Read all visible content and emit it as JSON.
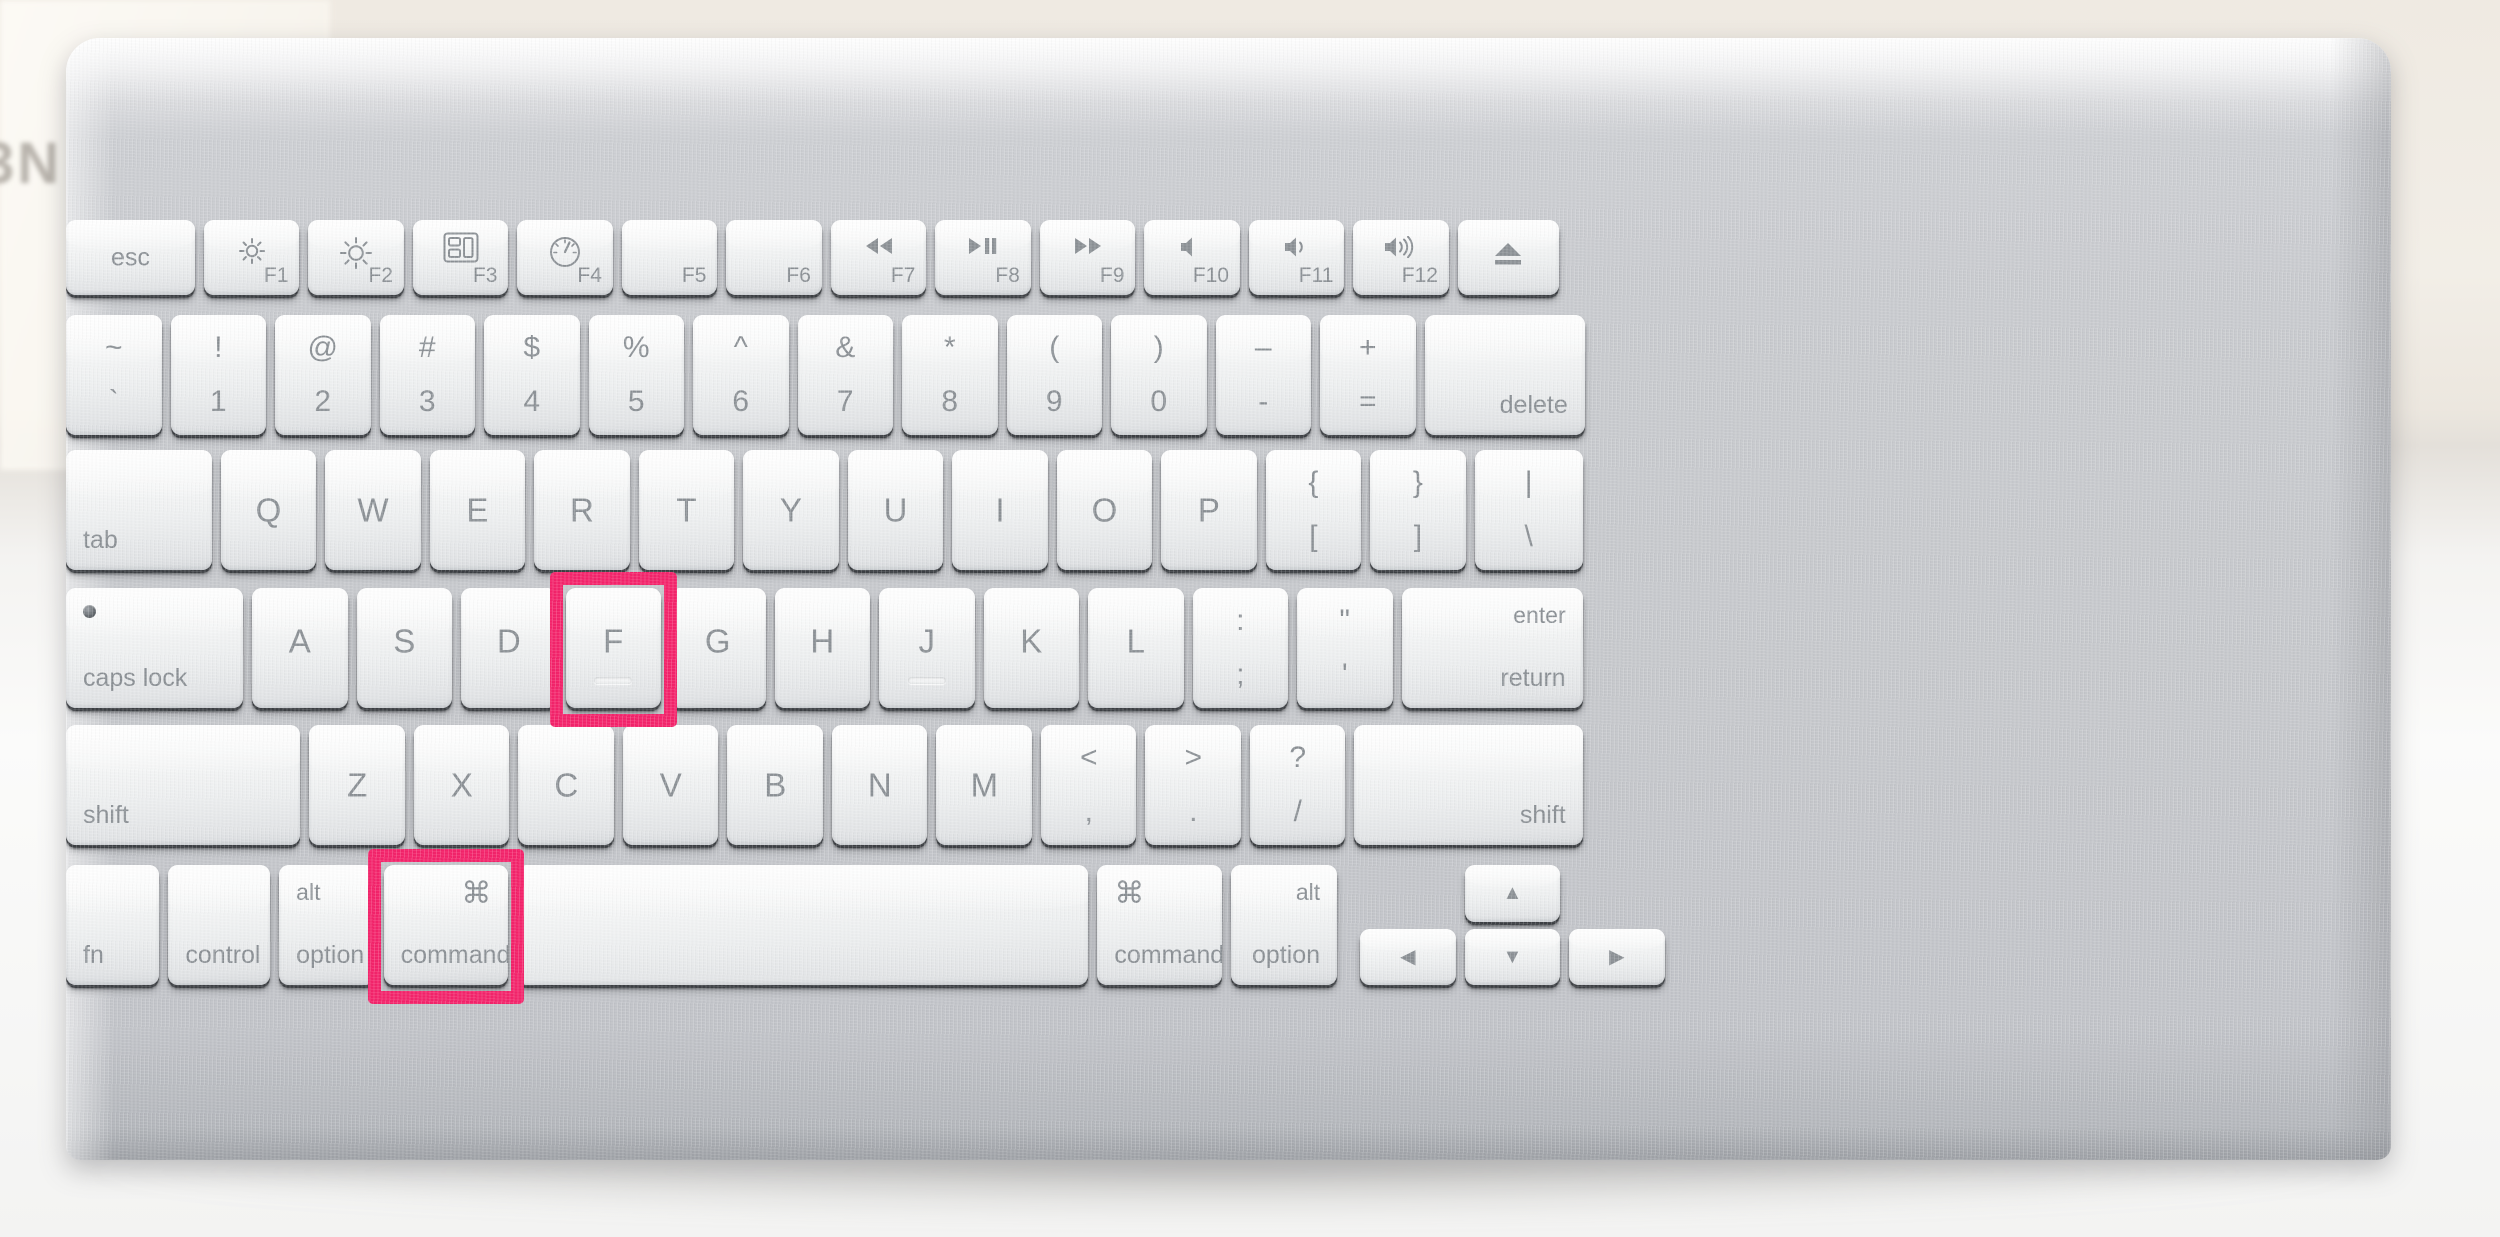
{
  "scene": {
    "device": "Apple Wireless Keyboard",
    "highlight_color": "#F4246B",
    "key_label_color": "#8c9196",
    "body_color": "#c6c8cc",
    "background_color": "#efece6"
  },
  "highlights": [
    {
      "name": "highlight-f-key",
      "key": "F"
    },
    {
      "name": "highlight-command-key",
      "key": "command"
    }
  ],
  "rows": {
    "function_row": [
      {
        "id": "esc",
        "label": "esc",
        "fn": ""
      },
      {
        "id": "f1",
        "label": "",
        "fn": "F1",
        "icon": "brightness-down-icon"
      },
      {
        "id": "f2",
        "label": "",
        "fn": "F2",
        "icon": "brightness-up-icon"
      },
      {
        "id": "f3",
        "label": "",
        "fn": "F3",
        "icon": "mission-control-icon"
      },
      {
        "id": "f4",
        "label": "",
        "fn": "F4",
        "icon": "dashboard-icon"
      },
      {
        "id": "f5",
        "label": "",
        "fn": "F5",
        "icon": ""
      },
      {
        "id": "f6",
        "label": "",
        "fn": "F6",
        "icon": ""
      },
      {
        "id": "f7",
        "label": "",
        "fn": "F7",
        "icon": "rewind-icon"
      },
      {
        "id": "f8",
        "label": "",
        "fn": "F8",
        "icon": "play-pause-icon"
      },
      {
        "id": "f9",
        "label": "",
        "fn": "F9",
        "icon": "fast-forward-icon"
      },
      {
        "id": "f10",
        "label": "",
        "fn": "F10",
        "icon": "mute-icon"
      },
      {
        "id": "f11",
        "label": "",
        "fn": "F11",
        "icon": "volume-down-icon"
      },
      {
        "id": "f12",
        "label": "",
        "fn": "F12",
        "icon": "volume-up-icon"
      },
      {
        "id": "eject",
        "label": "",
        "fn": "",
        "icon": "eject-icon"
      }
    ],
    "number_row": [
      {
        "id": "grave",
        "top": "~",
        "bottom": "`"
      },
      {
        "id": "1",
        "top": "!",
        "bottom": "1"
      },
      {
        "id": "2",
        "top": "@",
        "bottom": "2"
      },
      {
        "id": "3",
        "top": "#",
        "bottom": "3"
      },
      {
        "id": "4",
        "top": "$",
        "bottom": "4"
      },
      {
        "id": "5",
        "top": "%",
        "bottom": "5"
      },
      {
        "id": "6",
        "top": "^",
        "bottom": "6"
      },
      {
        "id": "7",
        "top": "&",
        "bottom": "7"
      },
      {
        "id": "8",
        "top": "*",
        "bottom": "8"
      },
      {
        "id": "9",
        "top": "(",
        "bottom": "9"
      },
      {
        "id": "0",
        "top": ")",
        "bottom": "0"
      },
      {
        "id": "minus",
        "top": "–",
        "bottom": "-"
      },
      {
        "id": "equal",
        "top": "+",
        "bottom": "="
      },
      {
        "id": "delete",
        "label": "delete"
      }
    ],
    "top_row": [
      {
        "id": "tab",
        "label": "tab"
      },
      {
        "id": "q",
        "label": "Q"
      },
      {
        "id": "w",
        "label": "W"
      },
      {
        "id": "e",
        "label": "E"
      },
      {
        "id": "r",
        "label": "R"
      },
      {
        "id": "t",
        "label": "T"
      },
      {
        "id": "y",
        "label": "Y"
      },
      {
        "id": "u",
        "label": "U"
      },
      {
        "id": "i",
        "label": "I"
      },
      {
        "id": "o",
        "label": "O"
      },
      {
        "id": "p",
        "label": "P"
      },
      {
        "id": "lbracket",
        "top": "{",
        "bottom": "["
      },
      {
        "id": "rbracket",
        "top": "}",
        "bottom": "]"
      },
      {
        "id": "backslash",
        "top": "|",
        "bottom": "\\"
      }
    ],
    "home_row": [
      {
        "id": "capslock",
        "label": "caps lock"
      },
      {
        "id": "a",
        "label": "A"
      },
      {
        "id": "s",
        "label": "S"
      },
      {
        "id": "d",
        "label": "D"
      },
      {
        "id": "f",
        "label": "F"
      },
      {
        "id": "g",
        "label": "G"
      },
      {
        "id": "h",
        "label": "H"
      },
      {
        "id": "j",
        "label": "J"
      },
      {
        "id": "k",
        "label": "K"
      },
      {
        "id": "l",
        "label": "L"
      },
      {
        "id": "semicolon",
        "top": ":",
        "bottom": ";"
      },
      {
        "id": "quote",
        "top": "\"",
        "bottom": "'"
      },
      {
        "id": "return",
        "top": "enter",
        "bottom": "return"
      }
    ],
    "shift_row": [
      {
        "id": "lshift",
        "label": "shift"
      },
      {
        "id": "z",
        "label": "Z"
      },
      {
        "id": "x",
        "label": "X"
      },
      {
        "id": "c",
        "label": "C"
      },
      {
        "id": "v",
        "label": "V"
      },
      {
        "id": "b",
        "label": "B"
      },
      {
        "id": "n",
        "label": "N"
      },
      {
        "id": "m",
        "label": "M"
      },
      {
        "id": "comma",
        "top": "<",
        "bottom": ","
      },
      {
        "id": "period",
        "top": ">",
        "bottom": "."
      },
      {
        "id": "slash",
        "top": "?",
        "bottom": "/"
      },
      {
        "id": "rshift",
        "label": "shift"
      }
    ],
    "bottom_row": [
      {
        "id": "fn",
        "label": "fn"
      },
      {
        "id": "control",
        "label": "control"
      },
      {
        "id": "loption",
        "top": "alt",
        "bottom": "option"
      },
      {
        "id": "lcommand",
        "top": "⌘",
        "bottom": "command"
      },
      {
        "id": "space",
        "label": ""
      },
      {
        "id": "rcommand",
        "top": "⌘",
        "bottom": "command"
      },
      {
        "id": "roption",
        "top": "alt",
        "bottom": "option"
      },
      {
        "id": "up",
        "label": "▲"
      },
      {
        "id": "left",
        "label": "◀"
      },
      {
        "id": "down",
        "label": "▼"
      },
      {
        "id": "right",
        "label": "▶"
      }
    ]
  }
}
